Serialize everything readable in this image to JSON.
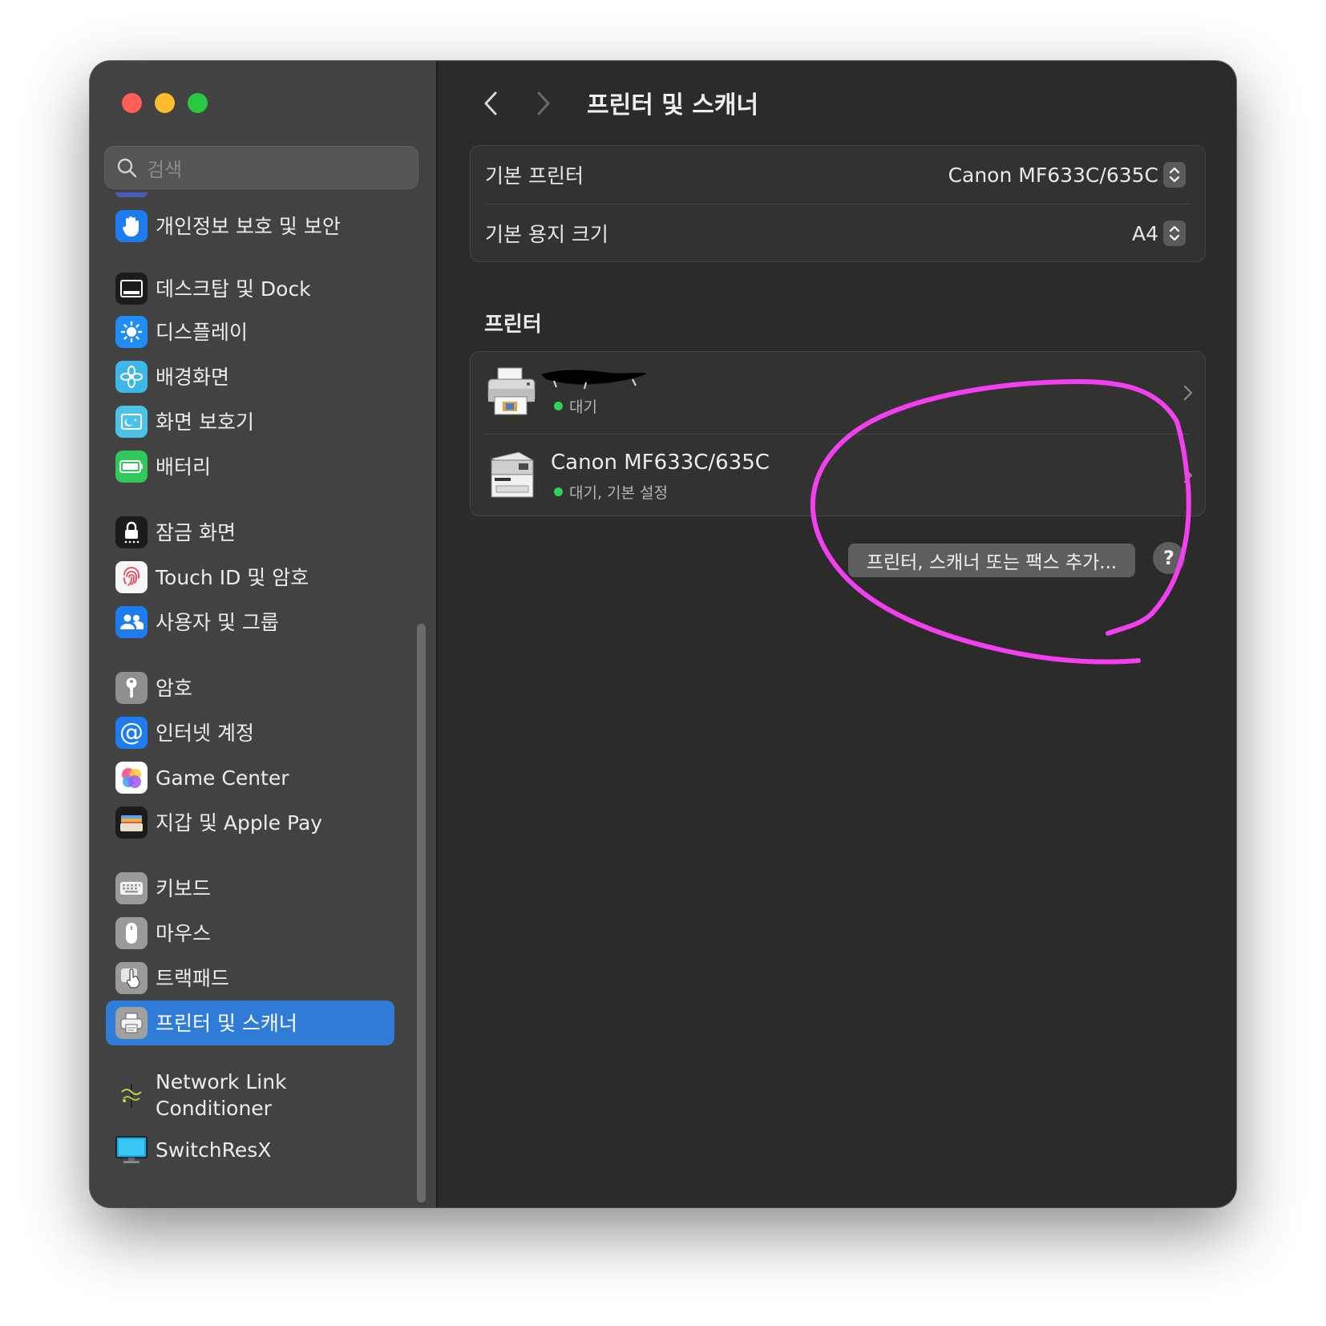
{
  "window": {
    "title": "프린터 및 스캐너"
  },
  "search": {
    "placeholder": "검색"
  },
  "sidebar": {
    "items": [
      {
        "label": "개인정보 보호 및 보안",
        "icon": "hand-icon"
      },
      {
        "label": "데스크탑 및 Dock",
        "icon": "dock-icon"
      },
      {
        "label": "디스플레이",
        "icon": "sun-icon"
      },
      {
        "label": "배경화면",
        "icon": "flower-icon"
      },
      {
        "label": "화면 보호기",
        "icon": "screensaver-icon"
      },
      {
        "label": "배터리",
        "icon": "battery-icon"
      },
      {
        "label": "잠금 화면",
        "icon": "lock-icon"
      },
      {
        "label": "Touch ID 및 암호",
        "icon": "fingerprint-icon"
      },
      {
        "label": "사용자 및 그룹",
        "icon": "users-icon"
      },
      {
        "label": "암호",
        "icon": "key-icon"
      },
      {
        "label": "인터넷 계정",
        "icon": "at-icon"
      },
      {
        "label": "Game Center",
        "icon": "game-center-icon"
      },
      {
        "label": "지갑 및 Apple Pay",
        "icon": "wallet-icon"
      },
      {
        "label": "키보드",
        "icon": "keyboard-icon"
      },
      {
        "label": "마우스",
        "icon": "mouse-icon"
      },
      {
        "label": "트랙패드",
        "icon": "trackpad-icon"
      },
      {
        "label": "프린터 및 스캐너",
        "icon": "printer-icon",
        "selected": true
      },
      {
        "label": "Network Link Conditioner",
        "icon": "network-link-icon"
      },
      {
        "label": "SwitchResX",
        "icon": "monitor-icon"
      }
    ]
  },
  "defaults": {
    "printer_label": "기본 프린터",
    "printer_value": "Canon MF633C/635C",
    "paper_label": "기본 용지 크기",
    "paper_value": "A4"
  },
  "printers": {
    "section_title": "프린터",
    "list": [
      {
        "name": "",
        "status": "대기",
        "name_redacted": true
      },
      {
        "name": "Canon MF633C/635C",
        "status": "대기, 기본 설정"
      }
    ]
  },
  "actions": {
    "add_label": "프린터, 스캐너 또는 팩스 추가...",
    "help_label": "?"
  },
  "colors": {
    "selection": "#2e7bd8",
    "annotation": "#f23ff0",
    "status_dot": "#30d158"
  }
}
